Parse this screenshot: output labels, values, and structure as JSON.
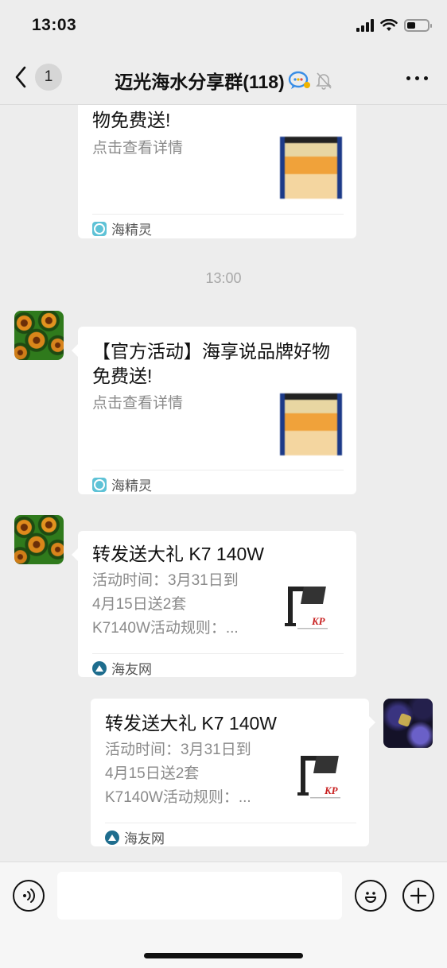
{
  "status_bar": {
    "time": "13:03",
    "battery_level": 0.4
  },
  "nav": {
    "back_count": "1",
    "title": "迈光海水分享群(118)"
  },
  "timestamp": "13:00",
  "messages": [
    {
      "title": "物免费送!",
      "desc": "点击查看详情",
      "source": "海精灵",
      "source_icon": "hjl-icon",
      "thumb": "poster"
    },
    {
      "title": "【官方活动】海享说品牌好物免费送!",
      "desc": "点击查看详情",
      "source": "海精灵",
      "source_icon": "hjl-icon",
      "thumb": "poster"
    },
    {
      "title": "转发送大礼 K7 140W",
      "desc": "活动时间：3月31日到\n4月15日送2套\nK7140W活动规则：...",
      "source": "海友网",
      "source_icon": "hyw-icon",
      "thumb": "lamp"
    },
    {
      "title": "转发送大礼 K7 140W",
      "desc": "活动时间：3月31日到\n4月15日送2套\nK7140W活动规则：...",
      "source": "海友网",
      "source_icon": "hyw-icon",
      "thumb": "lamp"
    }
  ],
  "colors": {
    "background": "#ededed",
    "card": "#ffffff",
    "muted_text": "#8a8a8a",
    "brand_blue": "#1c3a88"
  }
}
